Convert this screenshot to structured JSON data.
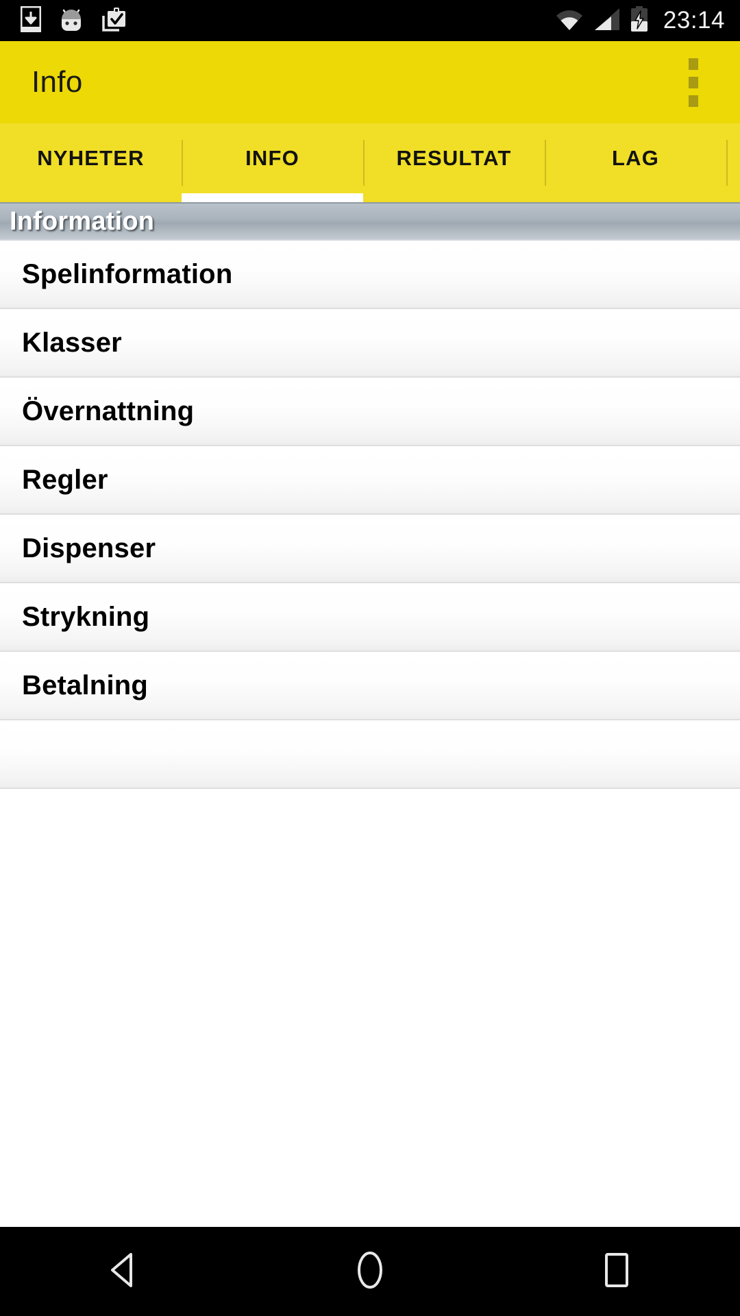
{
  "status_bar": {
    "time": "23:14",
    "left_icons": [
      {
        "name": "download-manager-icon",
        "glyph": "download-in-phone"
      },
      {
        "name": "android-head-icon",
        "glyph": "android-robot"
      },
      {
        "name": "clipboard-check-icon",
        "glyph": "clipboard-check"
      }
    ],
    "right_icons": [
      {
        "name": "wifi-icon",
        "glyph": "wifi-signal"
      },
      {
        "name": "cellular-signal-icon",
        "glyph": "signal-bars"
      },
      {
        "name": "battery-charging-icon",
        "glyph": "battery-bolt"
      }
    ],
    "background_color": "#000000",
    "text_color": "#f1f1f1"
  },
  "action_bar": {
    "title": "Info",
    "background_color": "#ecd905",
    "title_color": "#1a1a1a",
    "overflow_label": "More options"
  },
  "tabs": {
    "background_color": "#f0de27",
    "indicator_color": "#ffffff",
    "active_index": 1,
    "items": [
      {
        "label": "NYHETER"
      },
      {
        "label": "INFO"
      },
      {
        "label": "RESULTAT"
      },
      {
        "label": "LAG"
      },
      {
        "label": ""
      }
    ]
  },
  "section_header": {
    "title": "Information",
    "text_color": "#ffffff"
  },
  "list": {
    "items": [
      {
        "label": "Spelinformation"
      },
      {
        "label": "Klasser"
      },
      {
        "label": "Övernattning"
      },
      {
        "label": "Regler"
      },
      {
        "label": "Dispenser"
      },
      {
        "label": "Strykning"
      },
      {
        "label": "Betalning"
      },
      {
        "label": ""
      }
    ]
  },
  "nav_bar": {
    "background_color": "#000000",
    "buttons": [
      {
        "name": "back",
        "label": "Back"
      },
      {
        "name": "home",
        "label": "Home"
      },
      {
        "name": "recents",
        "label": "Recent apps"
      }
    ]
  }
}
